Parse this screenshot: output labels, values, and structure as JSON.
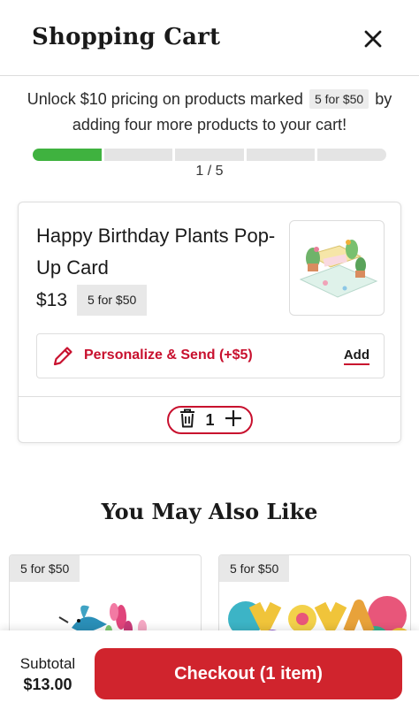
{
  "header": {
    "title": "Shopping Cart",
    "close_icon": "close-icon"
  },
  "promo": {
    "text_before": "Unlock $10 pricing on products marked",
    "badge": "5 for $50",
    "text_after": "by adding four more products to your cart!"
  },
  "progress": {
    "filled": 1,
    "total": 5,
    "label": "1 / 5"
  },
  "cart_item": {
    "name": "Happy Birthday Plants Pop-Up Card",
    "price": "$13",
    "badge": "5 for $50",
    "personalize_label": "Personalize & Send (+$5)",
    "personalize_action": "Add",
    "quantity": "1",
    "icons": [
      "trash-icon",
      "plus-icon",
      "pencil-icon"
    ]
  },
  "recommendations": {
    "title": "You May Also Like",
    "items": [
      {
        "badge": "5 for $50",
        "image": "hummingbird-flowers-card"
      },
      {
        "badge": "5 for $50",
        "image": "yay-balloon-letters-card"
      }
    ]
  },
  "footer": {
    "subtotal_label": "Subtotal",
    "subtotal_value": "$13.00",
    "checkout_label": "Checkout (1 item)"
  },
  "colors": {
    "accent": "#c8102e",
    "button": "#d0242d",
    "progress": "#3fb23f",
    "badge_bg": "#e8e8e8"
  }
}
